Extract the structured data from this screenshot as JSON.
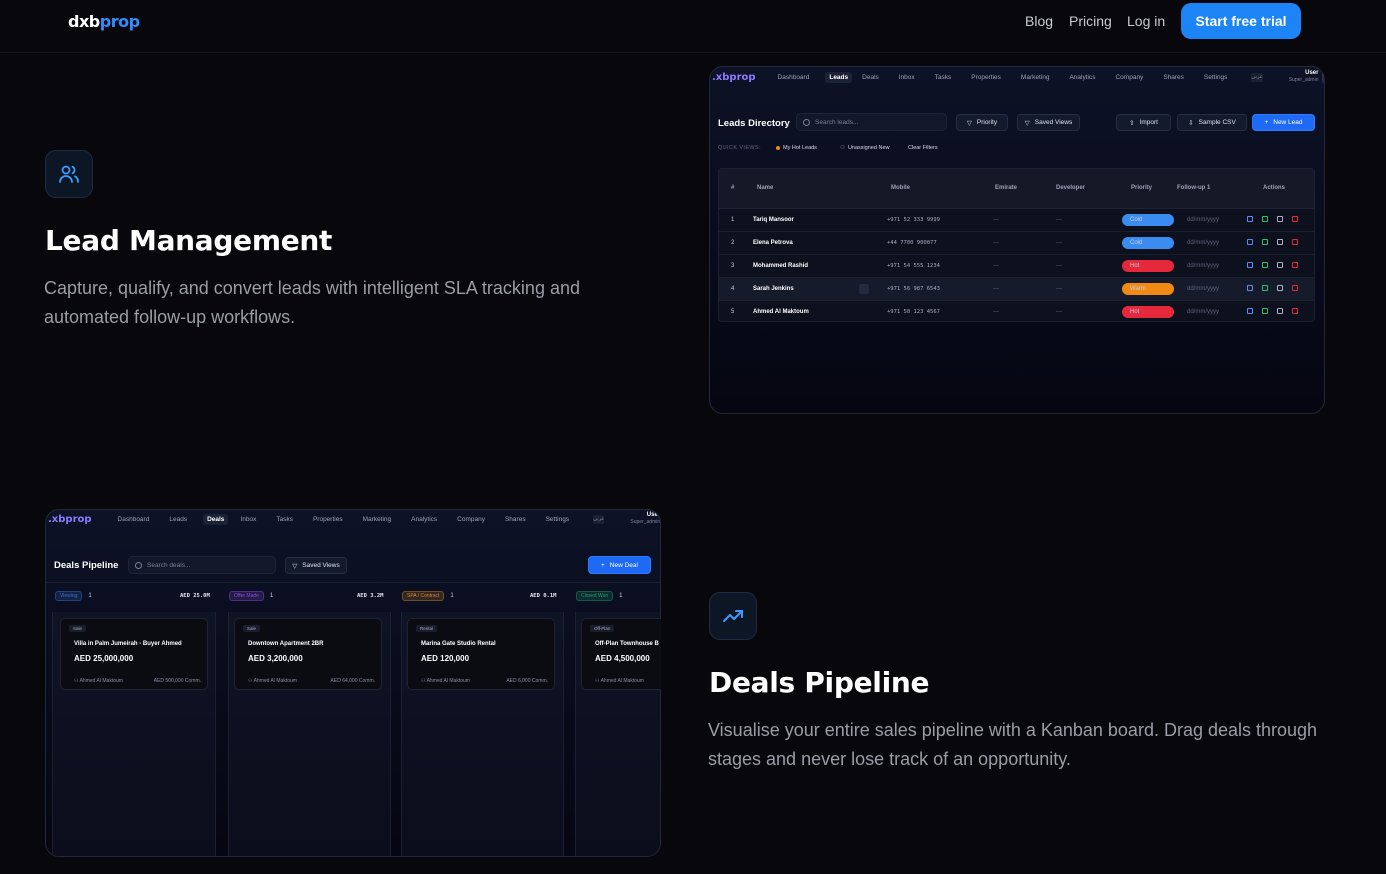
{
  "header": {
    "logo_part1": "dxb",
    "logo_part2": "prop",
    "nav": [
      "Blog",
      "Pricing",
      "Log in"
    ],
    "cta": "Start free trial"
  },
  "features": [
    {
      "icon": "users-icon",
      "title": "Lead Management",
      "description": "Capture, qualify, and convert leads with intelligent SLA tracking and automated follow-up workflows."
    },
    {
      "icon": "trending-up-icon",
      "title": "Deals Pipeline",
      "description": "Visualise your entire sales pipeline with a Kanban board. Drag deals through stages and never lose track of an opportunity."
    }
  ],
  "app": {
    "logo": ".xbprop",
    "nav": [
      "Dashboard",
      "Leads",
      "Deals",
      "Inbox",
      "Tasks",
      "Properties",
      "Marketing",
      "Analytics",
      "Company",
      "Shares",
      "Settings"
    ],
    "lang_badge": "عربي",
    "user_name": "User",
    "user_role": "Super_admin"
  },
  "leads": {
    "title": "Leads Directory",
    "search_placeholder": "Search leads...",
    "filters": [
      "Priority",
      "Saved Views"
    ],
    "actions": [
      "Import",
      "Sample CSV",
      "New Lead"
    ],
    "quick_views_label": "QUICK VIEWS:",
    "quick_views": [
      "My Hot Leads",
      "Unassigned New",
      "Clear Filters"
    ],
    "columns": [
      "#",
      "Name",
      "Mobile",
      "Emirate",
      "Developer",
      "Priority",
      "Follow-up 1",
      "Actions"
    ],
    "rows": [
      {
        "n": "1",
        "name": "Tariq Mansoor",
        "mobile": "+971 52 333 9999",
        "emirate": "—",
        "developer": "—",
        "priority": "Cold",
        "followup": "dd/mm/yyyy"
      },
      {
        "n": "2",
        "name": "Elena Petrova",
        "mobile": "+44 7700 900077",
        "emirate": "—",
        "developer": "—",
        "priority": "Cold",
        "followup": "dd/mm/yyyy"
      },
      {
        "n": "3",
        "name": "Mohammed Rashid",
        "mobile": "+971 54 555 1234",
        "emirate": "—",
        "developer": "—",
        "priority": "Hot",
        "followup": "dd/mm/yyyy"
      },
      {
        "n": "4",
        "name": "Sarah Jenkins",
        "mobile": "+971 56 987 6543",
        "emirate": "—",
        "developer": "—",
        "priority": "Warm",
        "followup": "dd/mm/yyyy"
      },
      {
        "n": "5",
        "name": "Ahmed Al Maktoum",
        "mobile": "+971 50 123 4567",
        "emirate": "—",
        "developer": "—",
        "priority": "Hot",
        "followup": "dd/mm/yyyy"
      }
    ],
    "priority_colors": {
      "Cold": "#3b8cf0",
      "Hot": "#e5283b",
      "Warm": "#f08a12"
    }
  },
  "deals": {
    "title": "Deals Pipeline",
    "search_placeholder": "Search deals...",
    "saved_views": "Saved Views",
    "new_deal": "New Deal",
    "stages": [
      {
        "name": "Viewing",
        "count": "1",
        "total": "AED 25.0M",
        "color": "#3b6fd4"
      },
      {
        "name": "Offer Made",
        "count": "1",
        "total": "AED 3.2M",
        "color": "#8a4be0"
      },
      {
        "name": "SPA / Contract",
        "count": "1",
        "total": "AED 0.1M",
        "color": "#d8862a"
      },
      {
        "name": "Closed Won",
        "count": "1",
        "total": "",
        "color": "#1f9e6a"
      }
    ],
    "cards": [
      {
        "type": "Sale",
        "title": "Villa in Palm Jumeirah - Buyer Ahmed",
        "amount": "AED 25,000,000",
        "owner": "Ahmed Al Maktoum",
        "commission": "AED 500,000 Comm."
      },
      {
        "type": "Sale",
        "title": "Downtown Apartment 2BR",
        "amount": "AED 3,200,000",
        "owner": "Ahmed Al Maktoum",
        "commission": "AED 64,000 Comm."
      },
      {
        "type": "Rental",
        "title": "Marina Gate Studio Rental",
        "amount": "AED 120,000",
        "owner": "Ahmed Al Maktoum",
        "commission": "AED 6,000 Comm."
      },
      {
        "type": "Off-Plan",
        "title": "Off-Plan Townhouse B",
        "amount": "AED 4,500,000",
        "owner": "Ahmed Al Maktoum",
        "commission": ""
      }
    ]
  }
}
